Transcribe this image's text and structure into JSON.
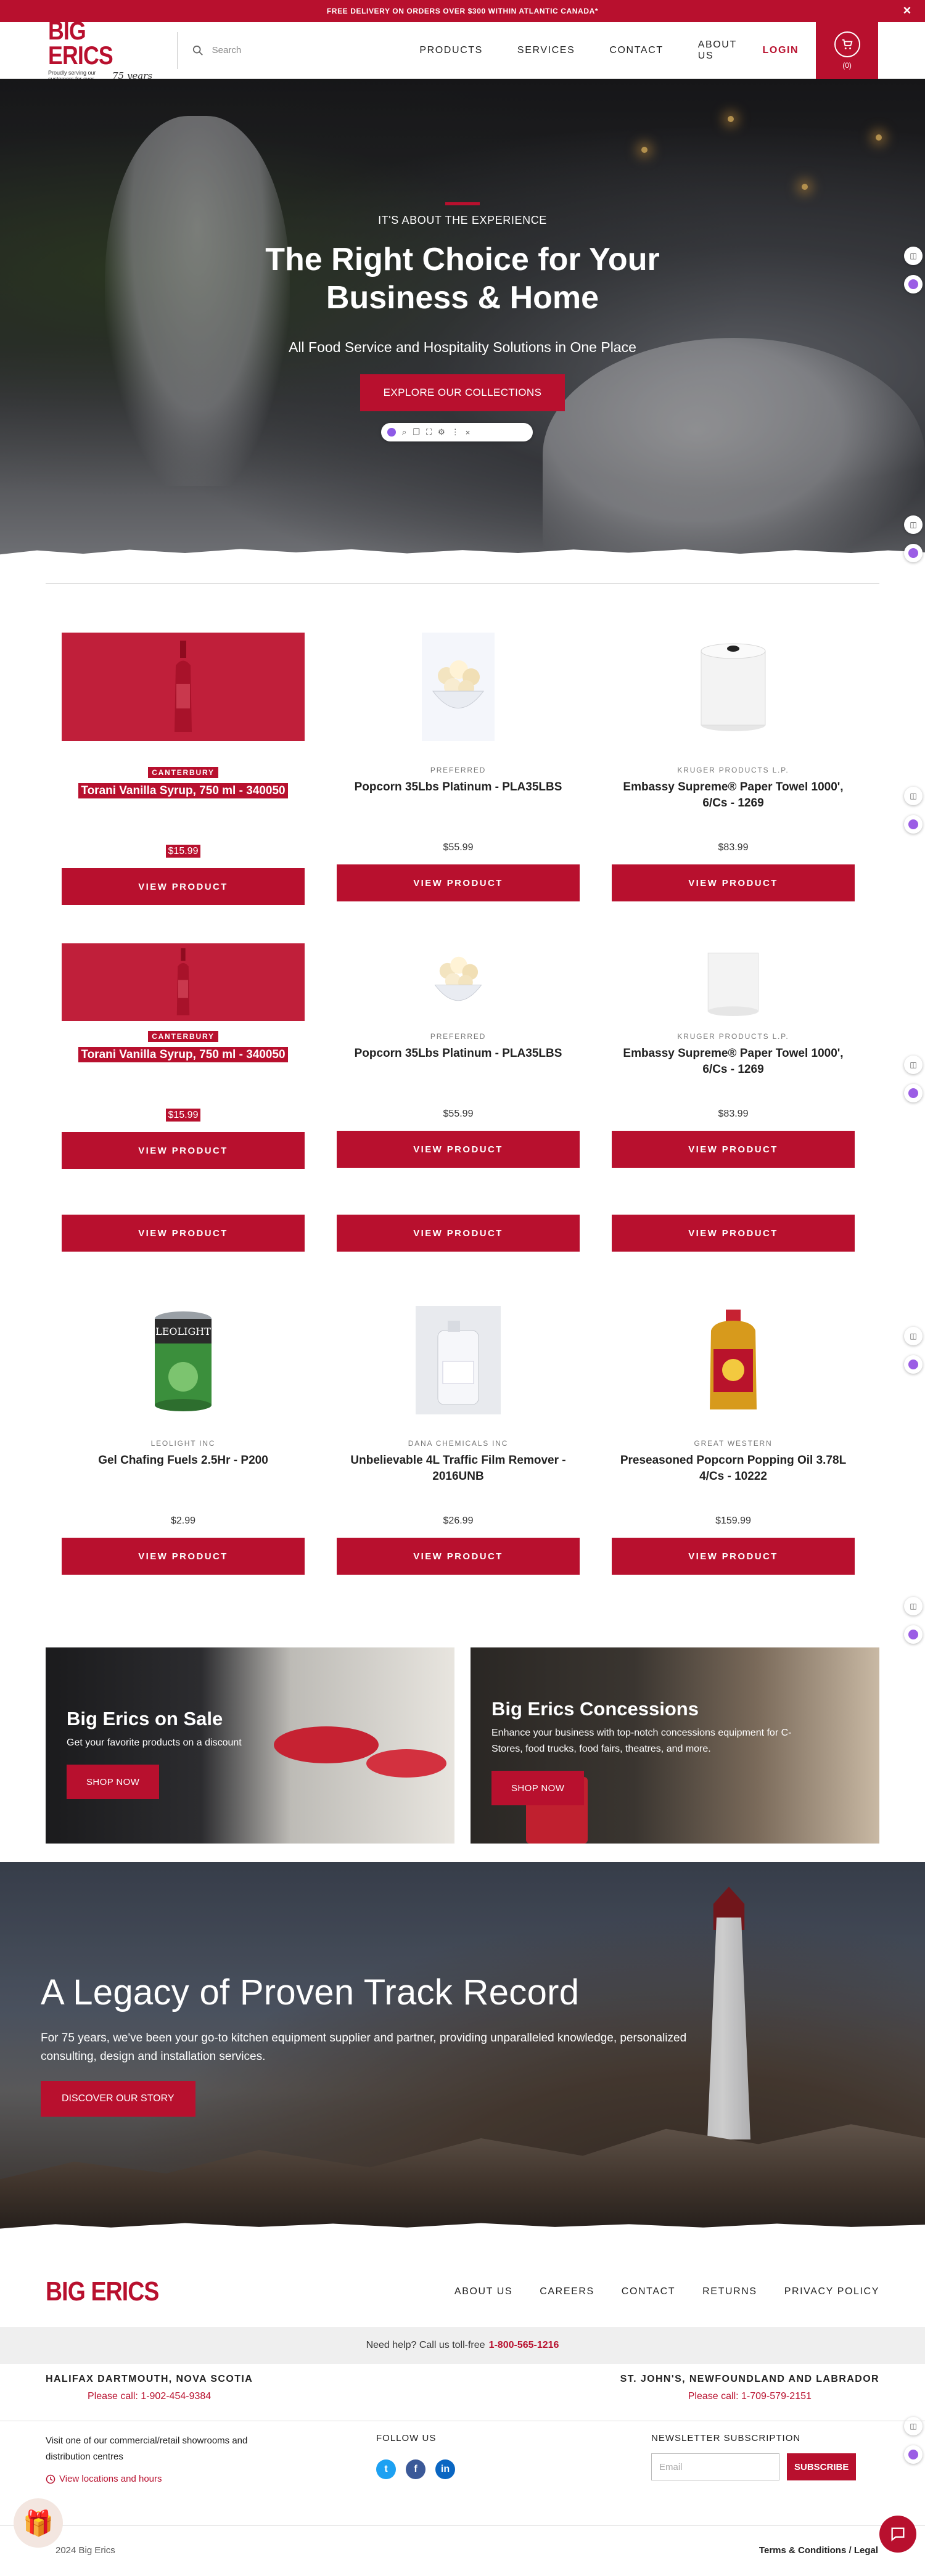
{
  "announcement": {
    "text": "FREE DELIVERY ON ORDERS OVER $300 WITHIN ATLANTIC CANADA*",
    "close": "×"
  },
  "header": {
    "logo": "BIG ERICS",
    "tagline": "Proudly serving our customers for over",
    "years": "75 years",
    "search_placeholder": "Search",
    "nav": [
      "PRODUCTS",
      "SERVICES",
      "CONTACT",
      "ABOUT US"
    ],
    "login": "LOGIN",
    "cart_count": "(0)"
  },
  "hero": {
    "eyebrow": "IT'S ABOUT THE EXPERIENCE",
    "title_line1": "The Right Choice for Your",
    "title_line2": "Business & Home",
    "subtitle": "All Food Service and Hospitality Solutions in One Place",
    "cta": "EXPLORE OUR COLLECTIONS"
  },
  "products_rows": [
    [
      {
        "brand": "CANTERBURY",
        "name": "Torani Vanilla Syrup, 750 ml - 340050",
        "price": "$15.99",
        "button": "VIEW PRODUCT",
        "selected": true,
        "image": "syrup-bottle-icon"
      },
      {
        "brand": "PREFERRED",
        "name": "Popcorn 35Lbs Platinum - PLA35LBS",
        "price": "$55.99",
        "button": "VIEW PRODUCT",
        "selected": false,
        "image": "popcorn-bowl-icon"
      },
      {
        "brand": "KRUGER PRODUCTS L.P.",
        "name": "Embassy Supreme® Paper Towel 1000', 6/Cs - 1269",
        "price": "$83.99",
        "button": "VIEW PRODUCT",
        "selected": false,
        "image": "paper-towel-roll-icon"
      }
    ],
    [
      {
        "brand": "CANTERBURY",
        "name": "Torani Vanilla Syrup, 750 ml - 340050",
        "price": "$15.99",
        "button": "VIEW PRODUCT",
        "selected": true,
        "image": "syrup-bottle-icon"
      },
      {
        "brand": "PREFERRED",
        "name": "Popcorn 35Lbs Platinum - PLA35LBS",
        "price": "$55.99",
        "button": "VIEW PRODUCT",
        "selected": false,
        "image": "popcorn-bowl-icon"
      },
      {
        "brand": "KRUGER PRODUCTS L.P.",
        "name": "Embassy Supreme® Paper Towel 1000', 6/Cs - 1269",
        "price": "$83.99",
        "button": "VIEW PRODUCT",
        "selected": false,
        "image": "paper-towel-roll-icon"
      }
    ],
    [
      {
        "brand": "LEOLIGHT INC",
        "name": "Gel Chafing Fuels 2.5Hr - P200",
        "price": "$2.99",
        "button": "VIEW PRODUCT",
        "selected": false,
        "image": "chafing-fuel-can-icon"
      },
      {
        "brand": "DANA CHEMICALS INC",
        "name": "Unbelievable 4L Traffic Film Remover - 2016UNB",
        "price": "$26.99",
        "button": "VIEW PRODUCT",
        "selected": false,
        "image": "chemical-jug-icon"
      },
      {
        "brand": "GREAT WESTERN",
        "name": "Preseasoned Popcorn Popping Oil 3.78L 4/Cs - 10222",
        "price": "$159.99",
        "button": "VIEW PRODUCT",
        "selected": false,
        "image": "oil-jug-icon"
      }
    ]
  ],
  "extra_buttons": [
    "VIEW PRODUCT",
    "VIEW PRODUCT",
    "VIEW PRODUCT"
  ],
  "fuel_can_label": "LEOLIGHT",
  "promos": [
    {
      "title": "Big Erics on Sale",
      "text": "Get your favorite products on a discount",
      "button": "SHOP NOW"
    },
    {
      "title": "Big Erics Concessions",
      "text": "Enhance your business with top-notch concessions equipment for C-Stores, food trucks, food fairs, theatres, and more.",
      "button": "SHOP NOW"
    }
  ],
  "legacy": {
    "title": "A Legacy of Proven Track Record",
    "text": "For 75 years, we've been your go-to kitchen equipment supplier and partner, providing unparalleled knowledge, personalized consulting, design and installation services.",
    "button": "DISCOVER OUR STORY"
  },
  "footer": {
    "logo": "BIG ERICS",
    "nav": [
      "ABOUT US",
      "CAREERS",
      "CONTACT",
      "RETURNS",
      "PRIVACY POLICY"
    ],
    "help_text": "Need help? Call us toll-free",
    "help_phone": "1-800-565-1216",
    "locations": [
      {
        "title": "HALIFAX DARTMOUTH, NOVA SCOTIA",
        "phone": "Please call: 1-902-454-9384"
      },
      {
        "title": "ST. JOHN'S, NEWFOUNDLAND AND LABRADOR",
        "phone": "Please call: 1-709-579-2151"
      }
    ],
    "visit_text": "Visit one of our commercial/retail showrooms and distribution centres",
    "visit_link": "View locations and hours",
    "follow_title": "FOLLOW US",
    "newsletter_title": "NEWSLETTER SUBSCRIPTION",
    "email_placeholder": "Email",
    "subscribe": "SUBSCRIBE",
    "copyright": "2024 Big Erics",
    "terms": "Terms & Conditions / Legal"
  },
  "colors": {
    "brand_red": "#b8102e",
    "facebook": "#3b5998",
    "twitter": "#1da1f2",
    "linkedin": "#0a66c2"
  }
}
